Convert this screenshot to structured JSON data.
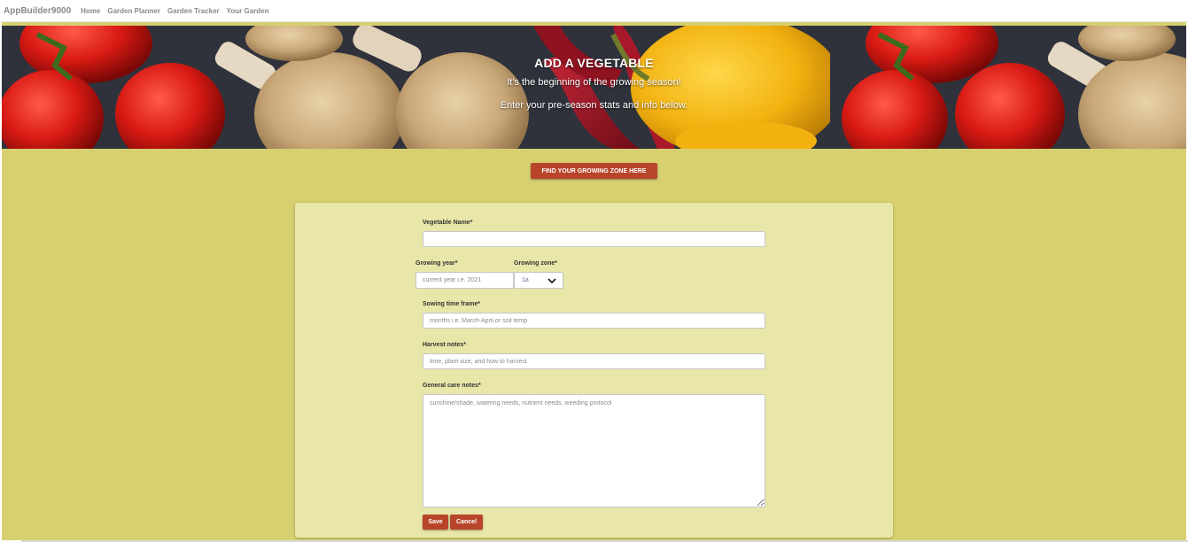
{
  "navbar": {
    "brand": "AppBuilder9000",
    "links": [
      "Home",
      "Garden Planner",
      "Garden Tracker",
      "Your Garden"
    ]
  },
  "hero": {
    "title": "ADD A VEGETABLE",
    "line1": "It's the beginning of the growing season!",
    "line2": "Enter your pre-season stats and info below."
  },
  "zone_button": "FIND YOUR GROWING ZONE HERE",
  "form": {
    "vegetable_name": {
      "label": "Vegetable Name*",
      "value": "",
      "placeholder": ""
    },
    "growing_year": {
      "label": "Growing year*",
      "placeholder": "current year i.e. 2021"
    },
    "growing_zone": {
      "label": "Growing zone*",
      "selected": "1a"
    },
    "sowing": {
      "label": "Sowing time frame*",
      "placeholder": "months i.e. March-April or soil temp"
    },
    "harvest": {
      "label": "Harvest notes*",
      "placeholder": "time, plant size, and how to harvest"
    },
    "care": {
      "label": "General care notes*",
      "placeholder": "sunshine/shade, watering needs, nutrient needs, weeding protocol"
    },
    "save_label": "Save",
    "cancel_label": "Cancel"
  },
  "colors": {
    "page_background": "#d7d070",
    "card_background": "#e8e6a8",
    "accent_button": "#b8452a"
  },
  "icons": {
    "zone_dropdown": "chevron-down-icon"
  }
}
